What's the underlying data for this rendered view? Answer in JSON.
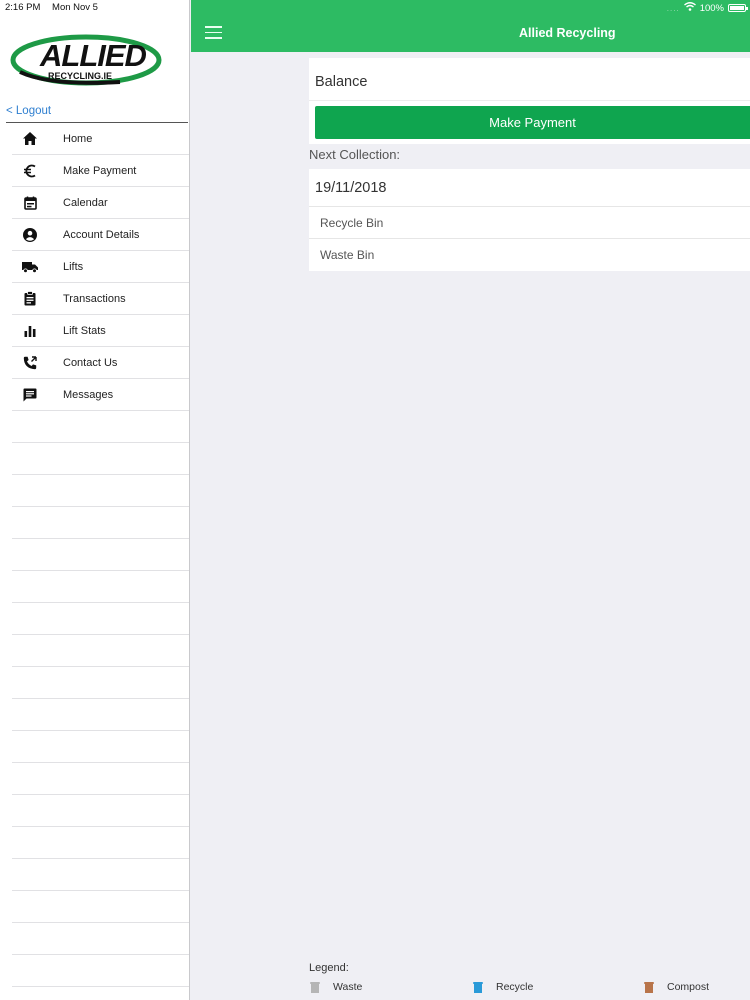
{
  "status_bar": {
    "time": "2:16 PM",
    "date": "Mon Nov 5",
    "battery": "100%"
  },
  "sidebar": {
    "logo_text": "ALLIED",
    "logo_subtext": "RECYCLING.IE",
    "logout_label": "< Logout",
    "items": [
      {
        "label": "Home",
        "icon": "home-icon"
      },
      {
        "label": "Make Payment",
        "icon": "euro-icon"
      },
      {
        "label": "Calendar",
        "icon": "calendar-icon"
      },
      {
        "label": "Account Details",
        "icon": "account-icon"
      },
      {
        "label": "Lifts",
        "icon": "truck-icon"
      },
      {
        "label": "Transactions",
        "icon": "clipboard-icon"
      },
      {
        "label": "Lift Stats",
        "icon": "bar-chart-icon"
      },
      {
        "label": "Contact Us",
        "icon": "phone-icon"
      },
      {
        "label": "Messages",
        "icon": "message-icon"
      }
    ]
  },
  "header": {
    "title": "Allied Recycling"
  },
  "main": {
    "balance_label": "Balance",
    "make_payment_label": "Make Payment",
    "next_collection_label": "Next Collection:",
    "collection_date": "19/11/2018",
    "bins": [
      "Recycle Bin",
      "Waste Bin"
    ]
  },
  "legend": {
    "title": "Legend:",
    "items": [
      {
        "label": "Waste",
        "color": "#b5b5b5"
      },
      {
        "label": "Recycle",
        "color": "#2a9ad8"
      },
      {
        "label": "Compost",
        "color": "#b8744a"
      }
    ]
  },
  "colors": {
    "accent": "#2dbb63",
    "button": "#0fa54f",
    "link": "#2f7fd0"
  }
}
